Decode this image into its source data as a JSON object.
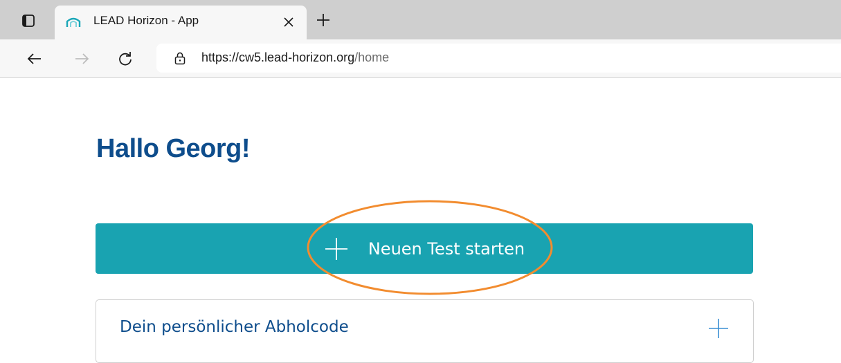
{
  "browser": {
    "tab": {
      "title": "LEAD Horizon - App",
      "close_icon": "close-icon",
      "favicon": "lead-horizon-favicon"
    },
    "new_tab_icon": "plus-icon",
    "url_host": "https://cw5.lead-horizon.org",
    "url_path": "/home",
    "icons": {
      "tab_actions": "tab-actions-icon",
      "back": "arrow-left-icon",
      "forward": "arrow-right-icon",
      "reload": "reload-icon",
      "lock": "lock-icon"
    }
  },
  "page": {
    "greeting": "Hallo Georg!",
    "primary_action": {
      "label": "Neuen Test starten",
      "icon": "plus-icon",
      "color": "#19a3b1"
    },
    "card": {
      "title": "Dein persönlicher Abholcode",
      "icon": "plus-icon"
    }
  },
  "colors": {
    "brand_blue": "#0e4d8c",
    "accent_teal": "#19a3b1",
    "highlight_orange": "#f28c2f"
  }
}
